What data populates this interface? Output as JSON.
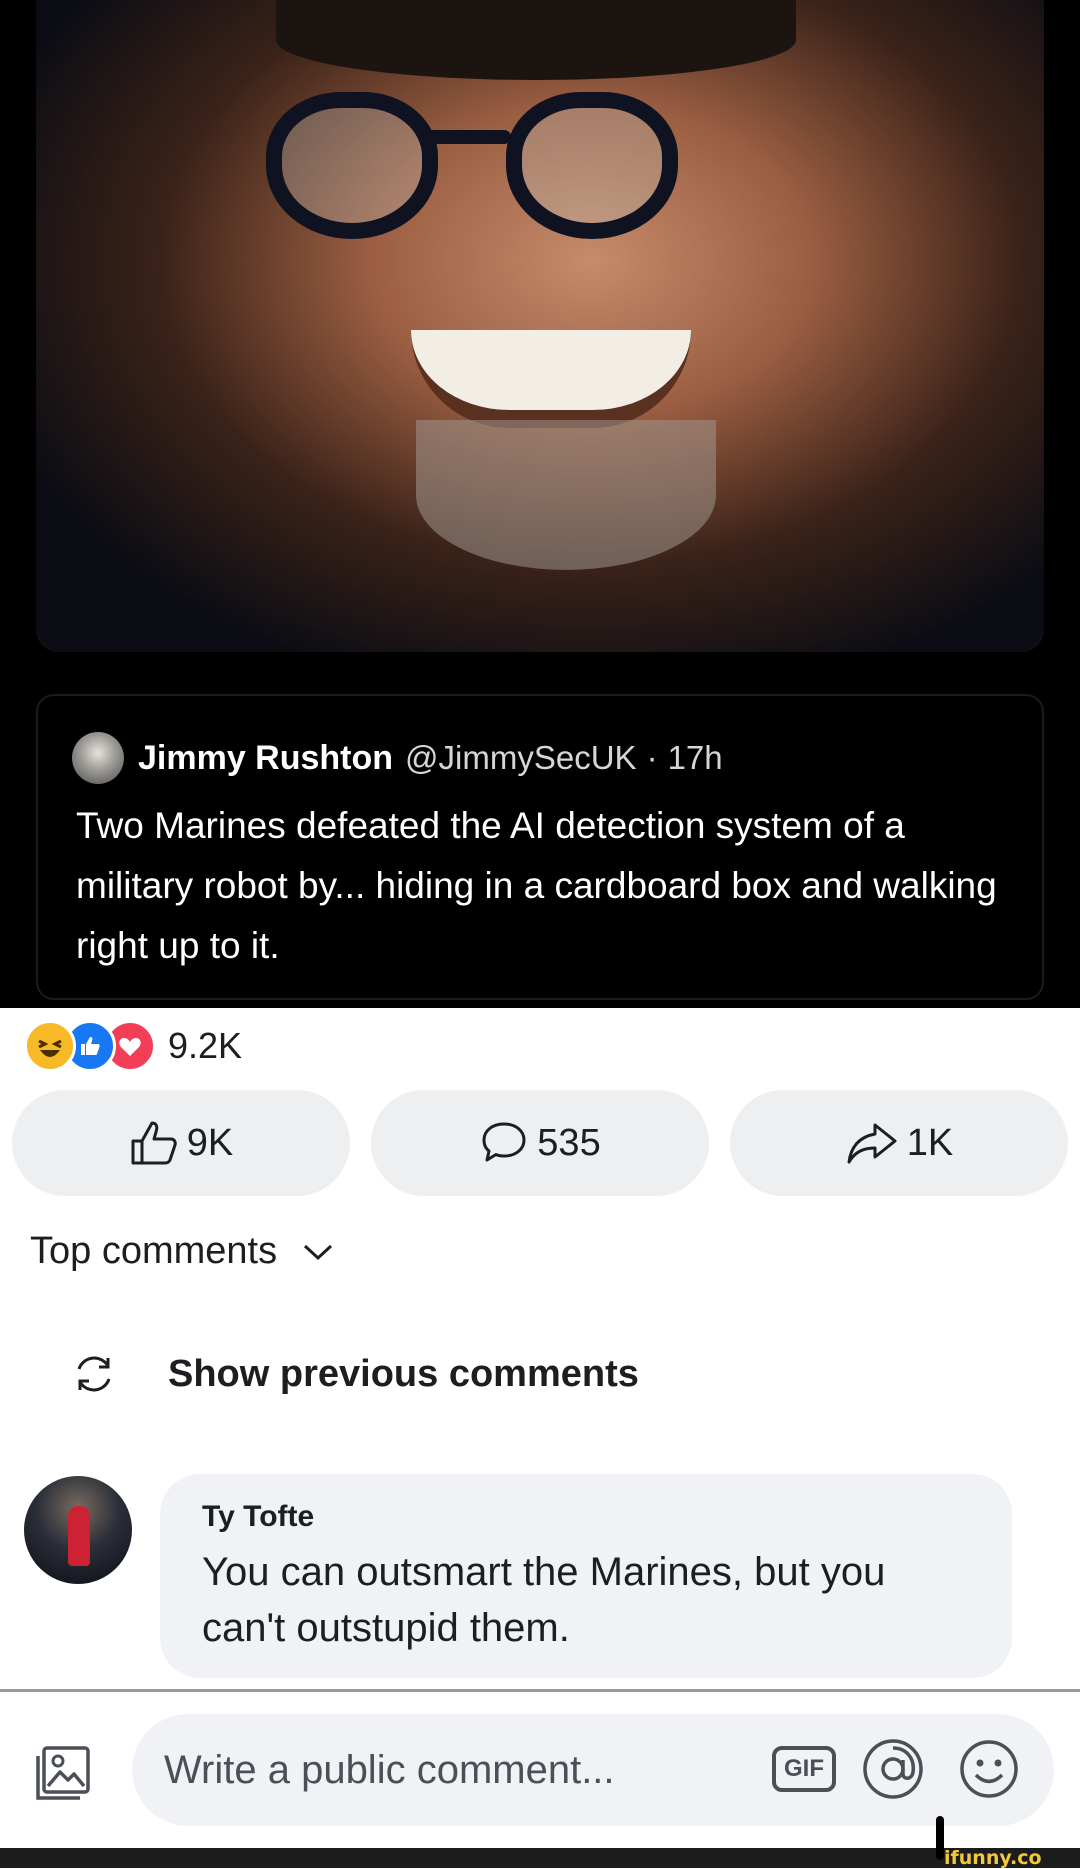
{
  "post": {
    "tweet": {
      "name": "Jimmy Rushton",
      "handle": "@JimmySecUK",
      "separator": "·",
      "time": "17h",
      "text": "Two Marines defeated the AI detection system of a military robot by... hiding in a cardboard box and walking right up to it."
    },
    "reactions": {
      "icons": [
        "haha-icon",
        "like-icon",
        "love-icon"
      ],
      "count": "9.2K"
    },
    "actions": {
      "like_count": "9K",
      "comment_count": "535",
      "share_count": "1K"
    }
  },
  "comments": {
    "sort_label": "Top comments",
    "show_previous_label": "Show previous comments",
    "items": [
      {
        "author": "Ty Tofte",
        "text": "You can outsmart the Marines, but you can't outstupid them."
      }
    ]
  },
  "composer": {
    "placeholder": "Write a public comment...",
    "gif_label": "GIF"
  },
  "watermark": "ifunny.co",
  "colors": {
    "like_blue": "#1877f2",
    "love_red": "#f33e58",
    "haha_yellow": "#f7b928",
    "button_gray": "#eeeff1",
    "bubble_gray": "#f0f2f5"
  }
}
